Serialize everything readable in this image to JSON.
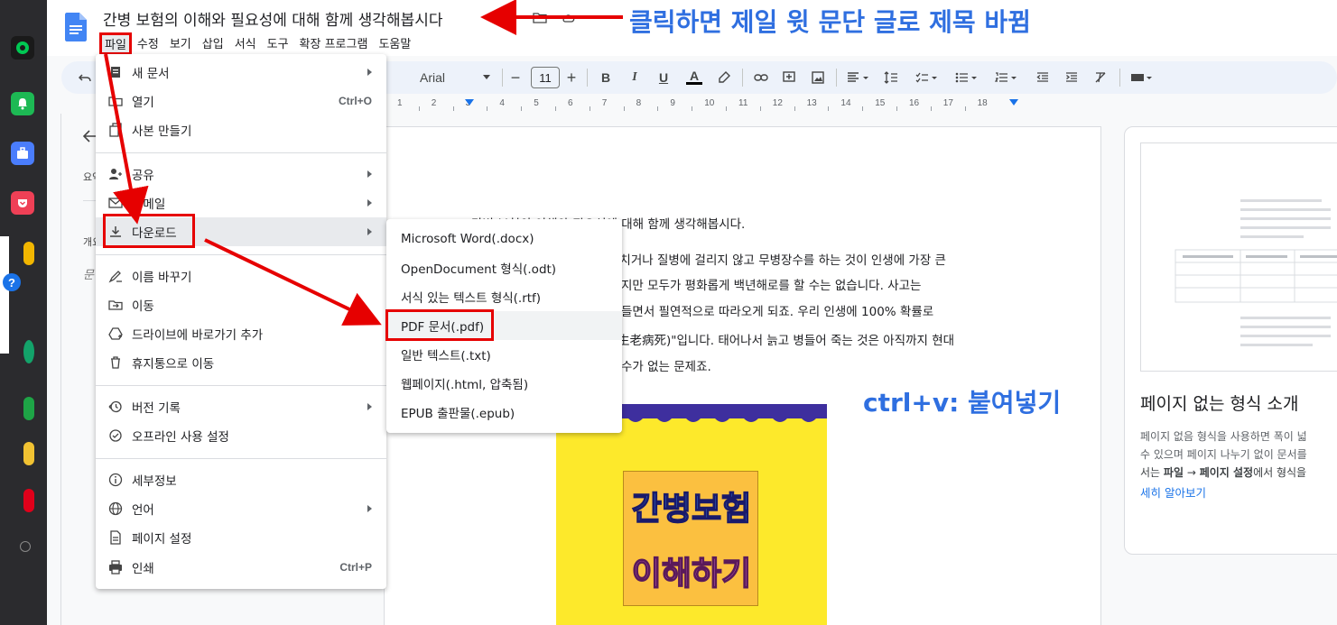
{
  "doc": {
    "title": "간병 보험의 이해와 필요성에 대해 함께 생각해봅시다",
    "menu": [
      "파일",
      "수정",
      "보기",
      "삽입",
      "서식",
      "도구",
      "확장 프로그램",
      "도움말"
    ]
  },
  "toolbar": {
    "font": "Arial",
    "font_size": "11",
    "bold": "B",
    "italic": "I",
    "underline": "U",
    "text_color": "A"
  },
  "ruler_numbers": [
    "1",
    "2",
    "3",
    "4",
    "5",
    "6",
    "7",
    "8",
    "9",
    "10",
    "11",
    "12",
    "13",
    "14",
    "15",
    "16",
    "17",
    "18"
  ],
  "outline": {
    "label_summary": "요약",
    "label_outline": "개요",
    "placeholder": "문"
  },
  "file_menu": {
    "items": [
      {
        "label": "새 문서",
        "shortcut": "",
        "submenu": true,
        "icon": "document-icon"
      },
      {
        "label": "열기",
        "shortcut": "Ctrl+O",
        "submenu": false,
        "icon": "folder-icon"
      },
      {
        "label": "사본 만들기",
        "shortcut": "",
        "submenu": false,
        "icon": "copy-icon"
      },
      {
        "label": "공유",
        "shortcut": "",
        "submenu": true,
        "icon": "share-person-icon"
      },
      {
        "label": "이메일",
        "shortcut": "",
        "submenu": true,
        "icon": "mail-icon"
      },
      {
        "label": "다운로드",
        "shortcut": "",
        "submenu": true,
        "icon": "download-icon"
      },
      {
        "label": "이름 바꾸기",
        "shortcut": "",
        "submenu": false,
        "icon": "rename-icon"
      },
      {
        "label": "이동",
        "shortcut": "",
        "submenu": false,
        "icon": "move-folder-icon"
      },
      {
        "label": "드라이브에 바로가기 추가",
        "shortcut": "",
        "submenu": false,
        "icon": "drive-shortcut-icon"
      },
      {
        "label": "휴지통으로 이동",
        "shortcut": "",
        "submenu": false,
        "icon": "trash-icon"
      },
      {
        "label": "버전 기록",
        "shortcut": "",
        "submenu": true,
        "icon": "history-icon"
      },
      {
        "label": "오프라인 사용 설정",
        "shortcut": "",
        "submenu": false,
        "icon": "offline-icon"
      },
      {
        "label": "세부정보",
        "shortcut": "",
        "submenu": false,
        "icon": "info-icon"
      },
      {
        "label": "언어",
        "shortcut": "",
        "submenu": true,
        "icon": "globe-icon"
      },
      {
        "label": "페이지 설정",
        "shortcut": "",
        "submenu": false,
        "icon": "page-icon"
      },
      {
        "label": "인쇄",
        "shortcut": "Ctrl+P",
        "submenu": false,
        "icon": "print-icon"
      }
    ]
  },
  "download_menu": {
    "items": [
      "Microsoft Word(.docx)",
      "OpenDocument 형식(.odt)",
      "서식 있는 텍스트 형식(.rtf)",
      "PDF 문서(.pdf)",
      "일반 텍스트(.txt)",
      "웹페이지(.html, 압축됨)",
      "EPUB 출판물(.epub)"
    ]
  },
  "body_lines": [
    "간병 보험의 이해와 필요성에 대해 함께 생각해봅시다.",
    "다치거나 질병에 걸리지 않고 무병장수를 하는 것이 인생에 가장 큰",
    "지만 모두가 평화롭게 백년해로를 할 수는 없습니다. 사고는",
    "들면서 필연적으로 따라오게 되죠. 우리 인생에 100% 확률로",
    "生老病死)\"입니다. 태어나서 늙고 병들어 죽는 것은 아직까지 현대",
    "수가 없는 문제죠."
  ],
  "poster": {
    "line1": "간병보험",
    "line2": "이해하기"
  },
  "right_panel": {
    "title": "페이지 없는 형식 소개",
    "body1": "페이지 없음 형식을 사용하면 폭이 넓",
    "body2": "수 있으며 페이지 나누기 없이 문서를",
    "body3_pre": "서는 ",
    "body3_b1": "파일",
    "body3_arrow": " → ",
    "body3_b2": "페이지 설정",
    "body3_post": "에서 형식을",
    "link": "세히 알아보기"
  },
  "annotations": {
    "title_note": "클릭하면 제일 윗 문단 글로 제목 바뀜",
    "paste_note": "ctrl+v: 붙여넣기"
  },
  "colors": {
    "annotation_blue": "#2f6fe0",
    "highlight_red": "#e60000",
    "docs_blue": "#4285f4"
  }
}
